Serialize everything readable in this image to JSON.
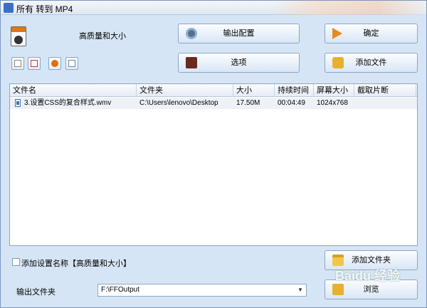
{
  "window": {
    "title": "所有 转到 MP4"
  },
  "header": {
    "profile_label": "高质量和大小"
  },
  "buttons": {
    "output_config": "输出配置",
    "ok": "确定",
    "options": "选项",
    "add_file": "添加文件",
    "add_folder": "添加文件夹",
    "browse": "浏览"
  },
  "toolbar": {
    "icons": [
      "new-file-icon",
      "remove-file-icon",
      "play-icon",
      "properties-icon"
    ]
  },
  "file_list": {
    "columns": [
      "文件名",
      "文件夹",
      "大小",
      "持续时间",
      "屏幕大小",
      "截取片断"
    ],
    "rows": [
      {
        "name": "3.设置CSS的复合样式.wmv",
        "folder": "C:\\Users\\lenovo\\Desktop",
        "size": "17.50M",
        "duration": "00:04:49",
        "resolution": "1024x768",
        "clip": ""
      }
    ]
  },
  "settings": {
    "add_setting_name_label": "添加设置名称【高质量和大小】",
    "add_setting_name_checked": false
  },
  "output": {
    "label": "输出文件夹",
    "folder": "F:\\FFOutput"
  },
  "watermark": {
    "text": "Baidu 经验"
  },
  "colors": {
    "window_bg": "#d6e5f5",
    "accent": "#3a70c4"
  }
}
